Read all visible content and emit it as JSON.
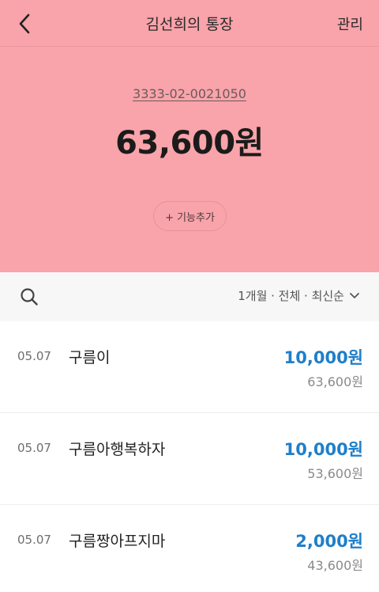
{
  "colors": {
    "hero": "#f9a3aa",
    "accent": "#1f7fc9"
  },
  "header": {
    "back_icon": "chevron-left-icon",
    "title": "김선희의 통장",
    "manage_label": "관리"
  },
  "account": {
    "number": "3333-02-0021050",
    "balance": "63,600원",
    "add_feature_label": "+ 기능추가"
  },
  "filter": {
    "search_icon": "search-icon",
    "label": "1개월 · 전체 · 최신순",
    "dropdown_icon": "chevron-down-icon"
  },
  "transactions": [
    {
      "date": "05.07",
      "name": "구름이",
      "amount": "10,000원",
      "balance_after": "63,600원"
    },
    {
      "date": "05.07",
      "name": "구름아행복하자",
      "amount": "10,000원",
      "balance_after": "53,600원"
    },
    {
      "date": "05.07",
      "name": "구름짱아프지마",
      "amount": "2,000원",
      "balance_after": "43,600원"
    }
  ]
}
